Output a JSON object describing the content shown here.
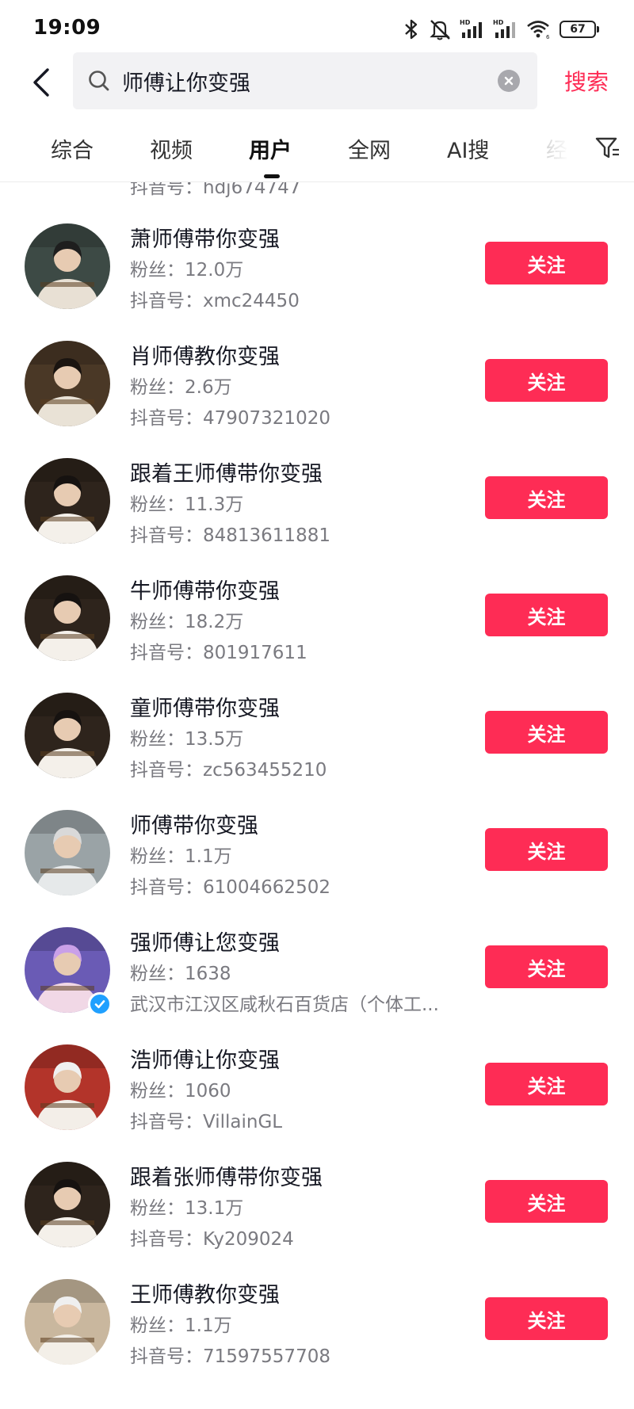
{
  "status_bar": {
    "time": "19:09",
    "battery": "67",
    "icons": [
      "bluetooth-icon",
      "mute-icon",
      "hd-signal-icon",
      "hd-signal-icon",
      "wifi-icon",
      "battery-icon"
    ]
  },
  "search": {
    "query": "师傅让你变强",
    "submit_label": "搜索",
    "icons": [
      "back-arrow-icon",
      "search-icon",
      "clear-icon"
    ]
  },
  "tabs": [
    {
      "label": "综合"
    },
    {
      "label": "视频"
    },
    {
      "label": "用户",
      "active": true
    },
    {
      "label": "全网"
    },
    {
      "label": "AI搜"
    },
    {
      "label": "经"
    }
  ],
  "filter_icon": "filter-icon",
  "fans_prefix": "粉丝：",
  "id_prefix": "抖音号：",
  "users": [
    {
      "name": "",
      "fans": "",
      "id": "hdj674747",
      "partial": true
    },
    {
      "name": "萧师傅带你变强",
      "fans": "12.0万",
      "id": "xmc24450",
      "follow": "关注"
    },
    {
      "name": "肖师傅教你变强",
      "fans": "2.6万",
      "id": "47907321020",
      "follow": "关注"
    },
    {
      "name": "跟着王师傅带你变强",
      "fans": "11.3万",
      "id": "84813611881",
      "follow": "关注"
    },
    {
      "name": "牛师傅带你变强",
      "fans": "18.2万",
      "id": "801917611",
      "follow": "关注"
    },
    {
      "name": "童师傅带你变强",
      "fans": "13.5万",
      "id": "zc563455210",
      "follow": "关注"
    },
    {
      "name": "师傅带你变强",
      "fans": "1.1万",
      "id": "61004662502",
      "follow": "关注"
    },
    {
      "name": "强师傅让您变强",
      "fans": "1638",
      "subtitle": "武汉市江汉区咸秋石百货店（个体工...",
      "verified": true,
      "follow": "关注"
    },
    {
      "name": "浩师傅让你变强",
      "fans": "1060",
      "id": "VillainGL",
      "follow": "关注"
    },
    {
      "name": "跟着张师傅带你变强",
      "fans": "13.1万",
      "id": "Ky209024",
      "follow": "关注"
    },
    {
      "name": "王师傅教你变强",
      "fans": "1.1万",
      "id": "71597557708",
      "follow": "关注"
    }
  ]
}
